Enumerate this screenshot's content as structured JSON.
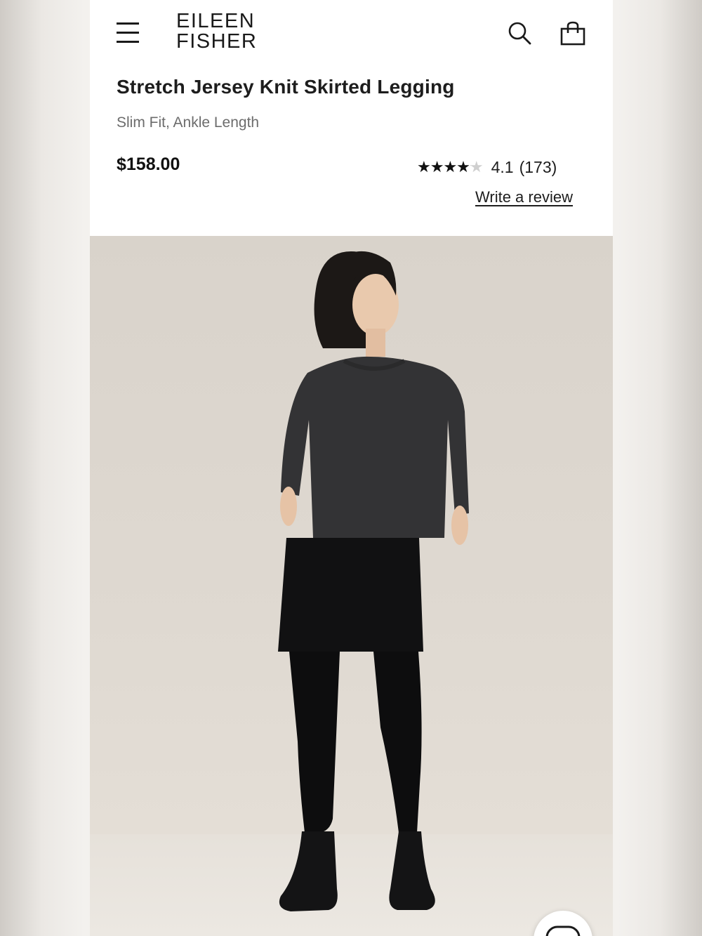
{
  "header": {
    "brand_line1": "EILEEN",
    "brand_line2": "FISHER",
    "icons": [
      "menu-icon",
      "search-icon",
      "shopping-bag-icon"
    ]
  },
  "product": {
    "title": "Stretch Jersey Knit Skirted Legging",
    "subtitle": "Slim Fit, Ankle Length",
    "price": "$158.00",
    "rating": {
      "stars_filled_fraction": 0.82,
      "value": "4.1",
      "count": "(173)"
    },
    "write_review_label": "Write a review"
  },
  "colors": {
    "text": "#1d1d1d",
    "subtitle": "#6c6c6c",
    "background": "#ffffff",
    "photo_backdrop": "#dcd6ce"
  },
  "chat": {
    "icon": "chat-bubble-icon"
  }
}
